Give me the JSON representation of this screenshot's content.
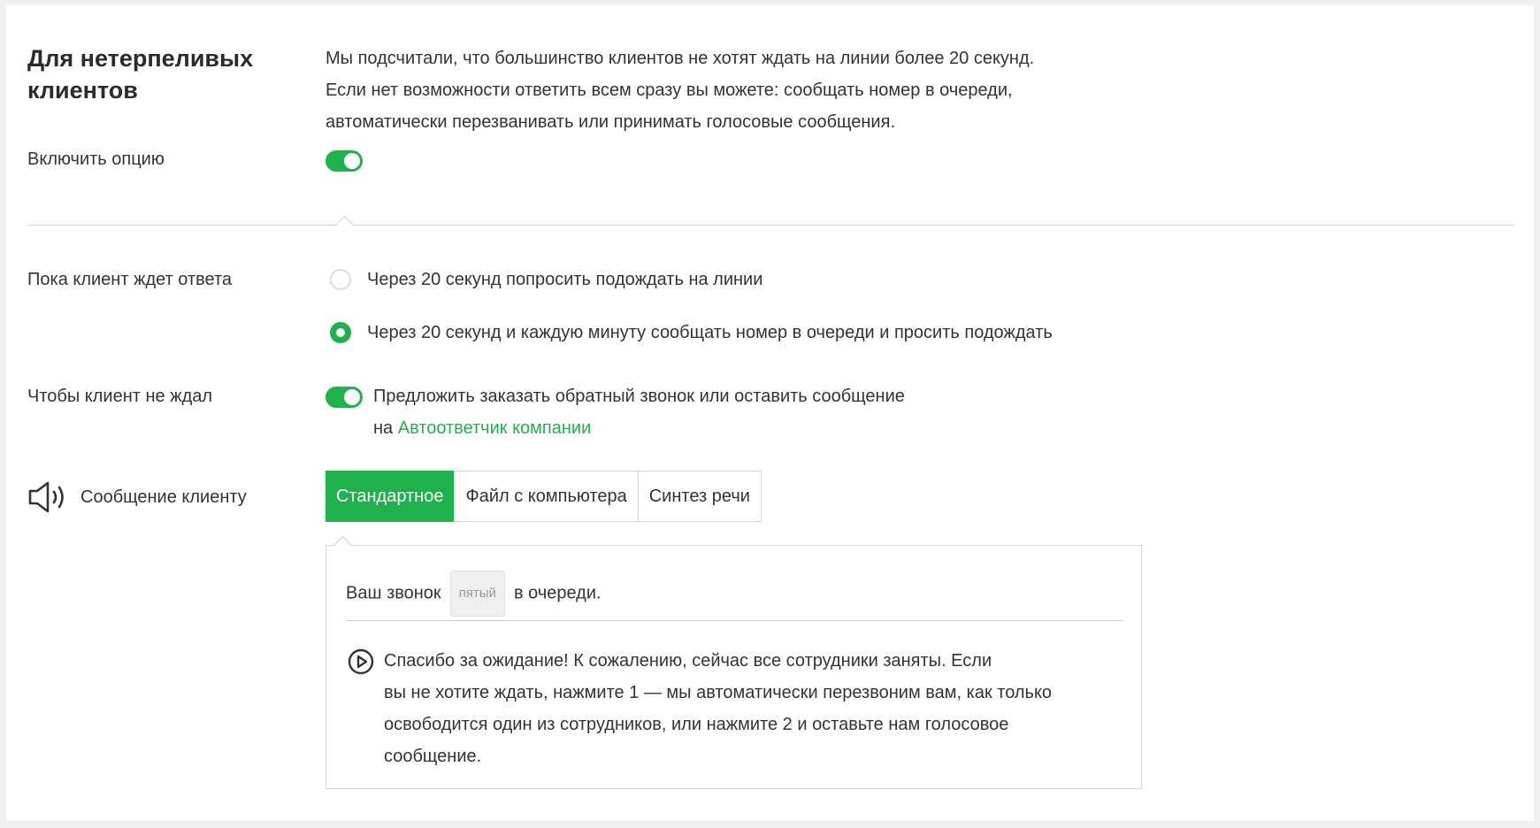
{
  "section": {
    "title": "Для нетерпеливых клиентов",
    "description_lines": [
      "Мы подсчитали, что большинство клиентов не хотят ждать на линии более 20 секунд.",
      "Если нет возможности ответить всем сразу вы можете: сообщать номер в очереди,",
      "автоматически перезванивать или принимать голосовые сообщения."
    ]
  },
  "enable_option": {
    "label": "Включить опцию",
    "toggle_on": true
  },
  "waiting": {
    "label": "Пока клиент ждет ответа",
    "options": [
      {
        "label": "Через 20 секунд попросить подождать на линии",
        "checked": false
      },
      {
        "label": "Через 20 секунд и каждую минуту сообщать номер в очереди и просить подождать",
        "checked": true
      }
    ]
  },
  "no_wait": {
    "label": "Чтобы клиент не ждал",
    "toggle_on": true,
    "text_line1": "Предложить заказать обратный звонок или оставить сообщение",
    "text_prefix": "на",
    "link_text": "Автоответчик компании"
  },
  "client_message": {
    "label": "Сообщение клиенту",
    "icon": "speaker-icon",
    "tabs": [
      {
        "label": "Стандартное",
        "active": true
      },
      {
        "label": "Файл с компьютера",
        "active": false
      },
      {
        "label": "Синтез речи",
        "active": false
      }
    ],
    "queue_text_before": "Ваш звонок",
    "queue_chip": "пятый",
    "queue_text_after": "в очереди.",
    "play_icon": "play-icon",
    "message_lines": [
      "Спасибо за ожидание! К сожалению, сейчас все сотрудники заняты. Если",
      "вы не хотите ждать, нажмите 1 — мы автоматически перезвоним вам, как только",
      "освободится один из сотрудников, или нажмите 2 и оставьте нам голосовое",
      "сообщение."
    ]
  },
  "colors": {
    "accent": "#1fb14c",
    "text": "#333333",
    "divider": "#cfcfcf",
    "background": "#f0f0f0"
  }
}
